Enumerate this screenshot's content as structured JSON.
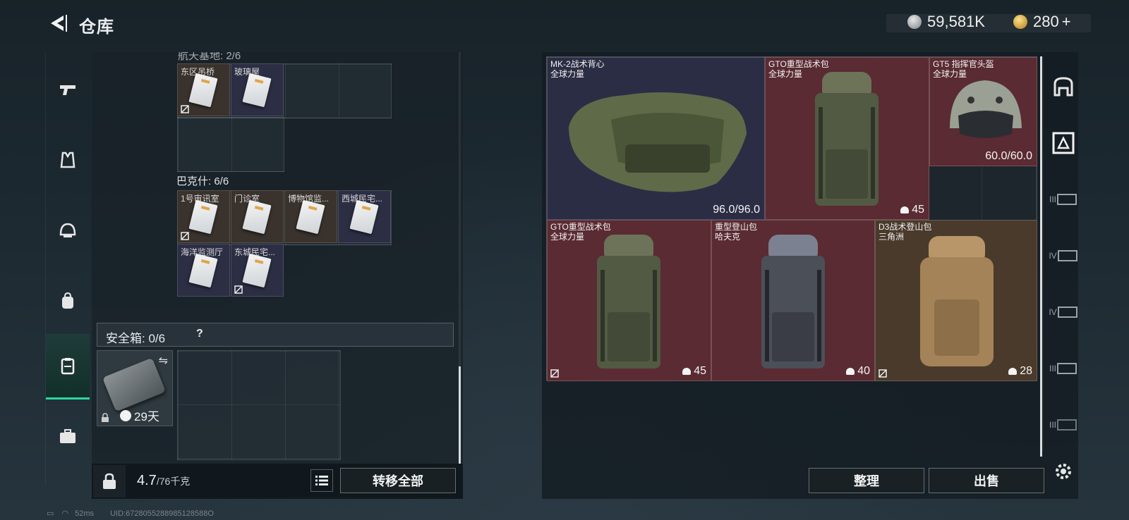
{
  "header": {
    "title": "仓库",
    "currency_silver": "59,581K",
    "currency_gold": "280",
    "currency_gold_plus": "+"
  },
  "left_nav": {
    "items": [
      {
        "name": "weapon"
      },
      {
        "name": "vest"
      },
      {
        "name": "helmet"
      },
      {
        "name": "backpack"
      },
      {
        "name": "container",
        "active": true
      },
      {
        "name": "case"
      }
    ]
  },
  "left_panel": {
    "top_section_label": "航天基地: 2/6",
    "top_cells": [
      {
        "label": "东区吊桥"
      },
      {
        "label": "玻璃屋"
      }
    ],
    "section2_label": "巴克什: 6/6",
    "section2_cells": [
      {
        "label": "1号审讯室"
      },
      {
        "label": "门诊室"
      },
      {
        "label": "博物馆监..."
      },
      {
        "label": "西城民宅..."
      },
      {
        "label": "海洋监测厅"
      },
      {
        "label": "东城民宅..."
      }
    ],
    "safebox_label": "安全箱: 0/6",
    "safebox_help": "?",
    "safe_item_timer": "29天"
  },
  "bottom_left": {
    "weight_value": "4.7",
    "weight_total": "/76千克",
    "transfer_all": "转移全部"
  },
  "stash": {
    "items": [
      {
        "name": "MK-2战术背心",
        "sub": "全球力量",
        "value": "96.0/96.0",
        "kind": "dura",
        "color": "navy"
      },
      {
        "name": "GTO重型战术包",
        "sub": "全球力量",
        "value": "45",
        "kind": "cap",
        "color": "red"
      },
      {
        "name": "GT5 指挥官头盔",
        "sub": "全球力量",
        "value": "60.0/60.0",
        "kind": "dura",
        "color": "red"
      },
      {
        "name": "GTO重型战术包",
        "sub": "全球力量",
        "value": "45",
        "kind": "cap",
        "color": "red"
      },
      {
        "name": "重型登山包",
        "sub": "哈夫克",
        "value": "40",
        "kind": "cap",
        "color": "red"
      },
      {
        "name": "D3战术登山包",
        "sub": "三角洲",
        "value": "28",
        "kind": "cap",
        "color": "tan"
      }
    ]
  },
  "bottom_right": {
    "sort": "整理",
    "sell": "出售"
  },
  "right_nav": {
    "tab_labels": [
      "",
      "",
      "III",
      "IV",
      "IV",
      "III",
      "III"
    ]
  },
  "status_bar": {
    "ping": "52ms",
    "uid": "UID:6728055288985128588O"
  }
}
